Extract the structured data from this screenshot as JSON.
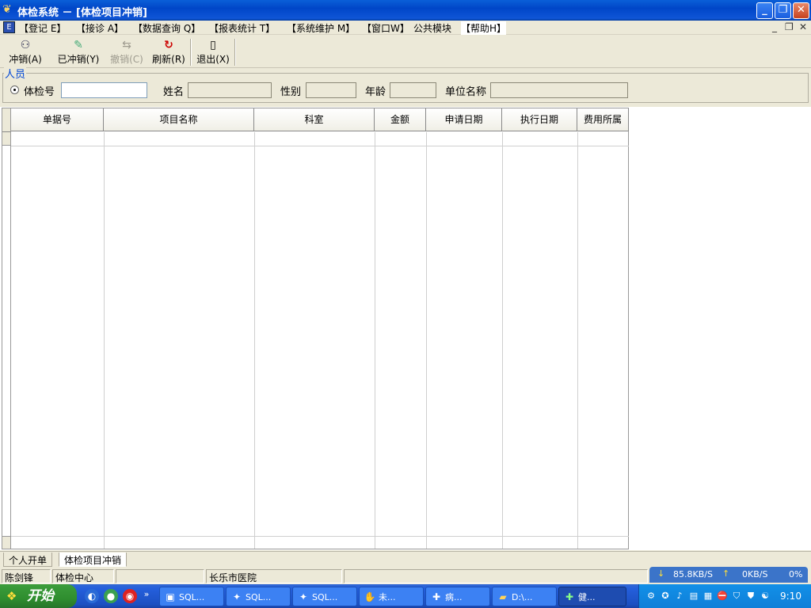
{
  "window": {
    "title": "体检系统 － [体检项目冲销]",
    "controls": {
      "minimize": "_",
      "restore": "❐",
      "close": "✕"
    }
  },
  "menubar": {
    "items": [
      "【登记 E】",
      "【接诊 A】",
      "【数据查询 Q】",
      "【报表统计 T】",
      "【系统维护 M】",
      "【窗口W】",
      "公共模块",
      "【帮助H】"
    ],
    "mdi_controls": {
      "minimize": "_",
      "restore": "❐",
      "close": "✕"
    }
  },
  "toolbar": {
    "buttons": [
      {
        "label": "冲销(A)",
        "icon": "people-icon",
        "disabled": false
      },
      {
        "label": "已冲销(Y)",
        "icon": "check-doc-icon",
        "disabled": false
      },
      {
        "label": "撤销(C)",
        "icon": "undo-icon",
        "disabled": true
      },
      {
        "label": "刷新(R)",
        "icon": "refresh-icon",
        "disabled": false
      },
      {
        "label": "退出(X)",
        "icon": "exit-door-icon",
        "disabled": false
      }
    ]
  },
  "person": {
    "legend": "人员",
    "radio_label": "体检号",
    "exam_no_value": "",
    "name_label": "姓名",
    "name_value": "",
    "gender_label": "性别",
    "gender_value": "",
    "age_label": "年龄",
    "age_value": "",
    "unit_label": "单位名称",
    "unit_value": ""
  },
  "grid": {
    "columns": [
      "单据号",
      "项目名称",
      "科室",
      "金额",
      "申请日期",
      "执行日期",
      "费用所属"
    ],
    "rows": []
  },
  "tabs": [
    "个人开单",
    "体检项目冲销"
  ],
  "status": {
    "user": "陈剑锋",
    "department": "体检中心",
    "blank": "",
    "hospital": "长乐市医院"
  },
  "netmeter": {
    "down": "85.8KB/S",
    "up": "0KB/S",
    "percent": "0%"
  },
  "taskbar": {
    "start_label": "开始",
    "tasks": [
      "SQL...",
      "SQL...",
      "SQL...",
      "未...",
      "病...",
      "D:\\...",
      "健..."
    ],
    "clock": "9:10"
  },
  "colors": {
    "titlebar": "#0046c8",
    "window_bg": "#ece9d8",
    "taskbar": "#245edb",
    "start": "#2f8e2f"
  }
}
